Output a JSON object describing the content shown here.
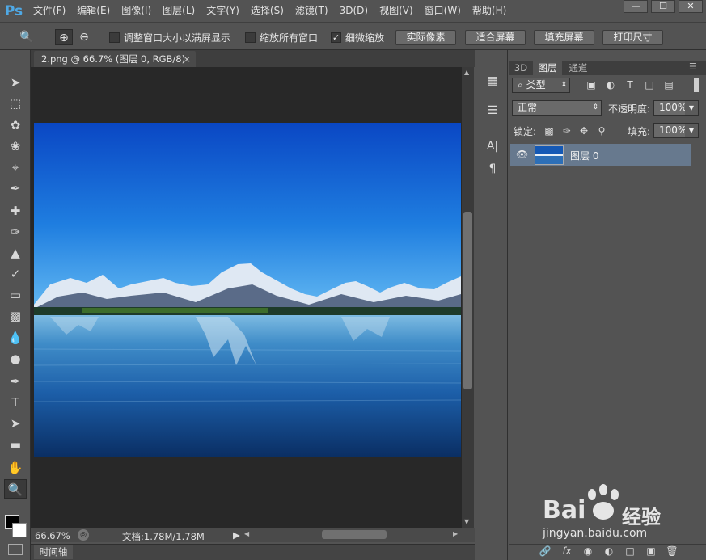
{
  "app": {
    "logo": "Ps"
  },
  "menu": [
    "文件(F)",
    "编辑(E)",
    "图像(I)",
    "图层(L)",
    "文字(Y)",
    "选择(S)",
    "滤镜(T)",
    "3D(D)",
    "视图(V)",
    "窗口(W)",
    "帮助(H)"
  ],
  "window_controls": {
    "minimize": "—",
    "maximize": "☐",
    "close": "✕"
  },
  "options": {
    "resize_windows": "调整窗口大小以满屏显示",
    "zoom_all": "缩放所有窗口",
    "scrubby_zoom": "细微缩放",
    "actual_pixels": "实际像素",
    "fit_screen": "适合屏幕",
    "fill_screen": "填充屏幕",
    "print_size": "打印尺寸",
    "resize_checked": false,
    "zoom_all_checked": false,
    "scrubby_checked": true
  },
  "document": {
    "tab_title": "2.png @ 66.7% (图层 0, RGB/8)",
    "tab_close": "×",
    "zoom_level": "66.67%",
    "doc_size": "文档:1.78M/1.78M"
  },
  "timeline_tab": "时间轴",
  "panels": {
    "tabs": [
      "3D",
      "图层",
      "通道"
    ],
    "filter_label": "类型",
    "blend_mode": "正常",
    "opacity_label": "不透明度:",
    "opacity_value": "100%",
    "lock_label": "锁定:",
    "fill_label": "填充:",
    "fill_value": "100%",
    "layers": [
      {
        "name": "图层 0",
        "visible": true
      }
    ]
  },
  "watermark": {
    "brand": "Bai",
    "brand2": "经验",
    "url": "jingyan.baidu.com"
  },
  "colors": {
    "accent_ps": "#4fa9e6",
    "layer_selected": "#67798e"
  }
}
